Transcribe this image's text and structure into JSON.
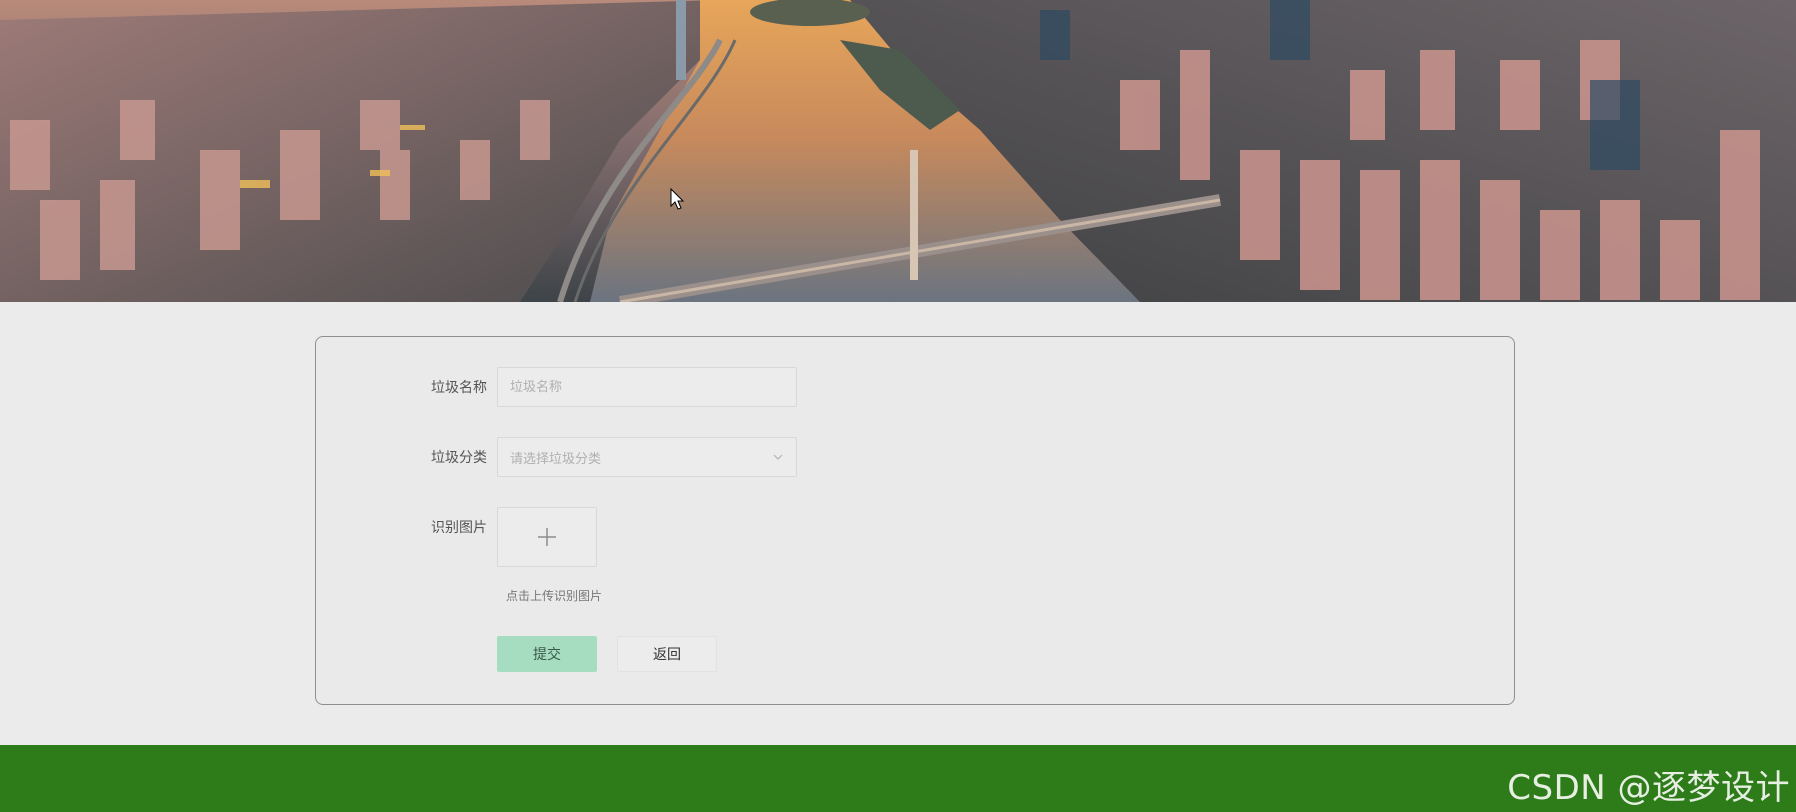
{
  "banner": {
    "image": "city-skyline-river-sunset"
  },
  "form": {
    "name_label": "垃圾名称",
    "name_placeholder": "垃圾名称",
    "name_value": "",
    "category_label": "垃圾分类",
    "category_placeholder": "请选择垃圾分类",
    "category_icon": "chevron-down-icon",
    "image_label": "识别图片",
    "upload_icon": "plus-icon",
    "upload_hint": "点击上传识别图片",
    "submit_label": "提交",
    "back_label": "返回"
  },
  "footer": {
    "watermark": "CSDN @逐梦设计"
  },
  "colors": {
    "page_bg": "#ebebeb",
    "footer_bg": "#2d7b19",
    "submit_bg": "#a6dcc0"
  }
}
